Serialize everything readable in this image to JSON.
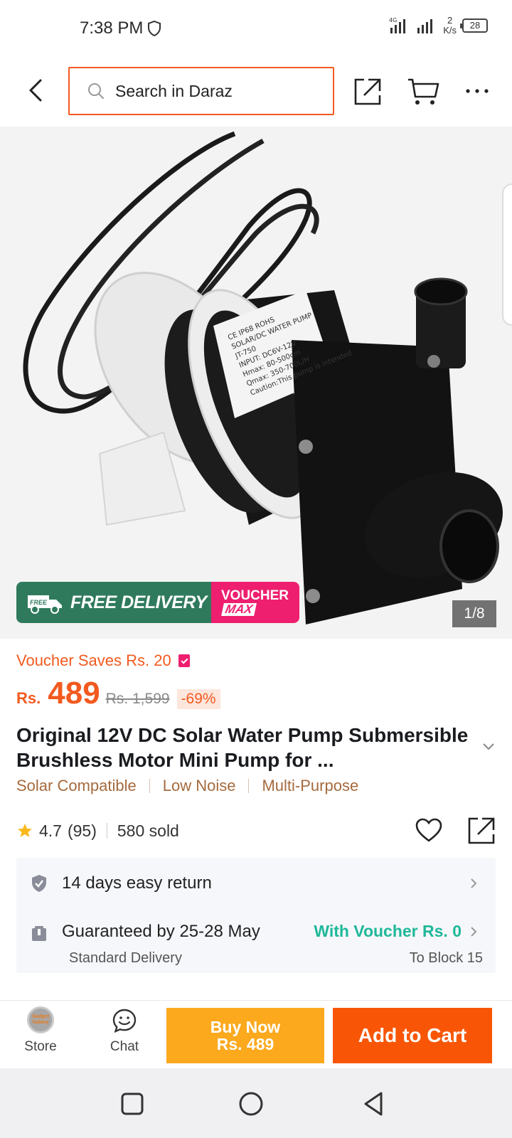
{
  "status_bar": {
    "time": "7:38 PM",
    "network": "4G",
    "speed_value": "2",
    "speed_unit": "K/s",
    "battery": "28"
  },
  "header": {
    "search_placeholder": "Search in Daraz"
  },
  "gallery": {
    "promo_free_delivery": "FREE DELIVERY",
    "promo_free_tag": "FREE",
    "promo_voucher_line1": "VOUCHER",
    "promo_voucher_line2": "MAX",
    "counter": "1/8",
    "label_lines": [
      "CE IP68 ROHS",
      "SOLAR/DC WATER PUMP",
      "JT-750",
      "INPUT: DC6V-12V",
      "Hmax: 80-500cm",
      "Qmax: 350-700L/H",
      "Caution:This pump is intended"
    ]
  },
  "product": {
    "voucher_saves": "Voucher Saves Rs. 20",
    "currency": "Rs.",
    "price": "489",
    "original_price": "Rs. 1,599",
    "discount": "-69%",
    "title": "Original 12V DC Solar Water Pump Submersible Brushless Motor Mini Pump for ...",
    "tags": [
      "Solar Compatible",
      "Low Noise",
      "Multi-Purpose"
    ],
    "rating": "4.7",
    "review_count": "(95)",
    "sold": "580 sold"
  },
  "services": {
    "return_policy": "14 days easy return",
    "delivery_guarantee": "Guaranteed by 25-28 May",
    "delivery_voucher": "With Voucher Rs. 0",
    "delivery_type": "Standard Delivery",
    "delivery_destination": "To Block 15"
  },
  "action_bar": {
    "store_logo_text": "Gadget Galaxy",
    "store_label": "Store",
    "chat_label": "Chat",
    "buy_now_line1": "Buy Now",
    "buy_now_line2": "Rs. 489",
    "add_to_cart": "Add to Cart"
  },
  "colors": {
    "brand_orange": "#f85606",
    "buy_now_yellow": "#fca91e",
    "voucher_green": "#1fb89a",
    "promo_green": "#2f7a5d",
    "promo_pink": "#ee1f6f"
  }
}
